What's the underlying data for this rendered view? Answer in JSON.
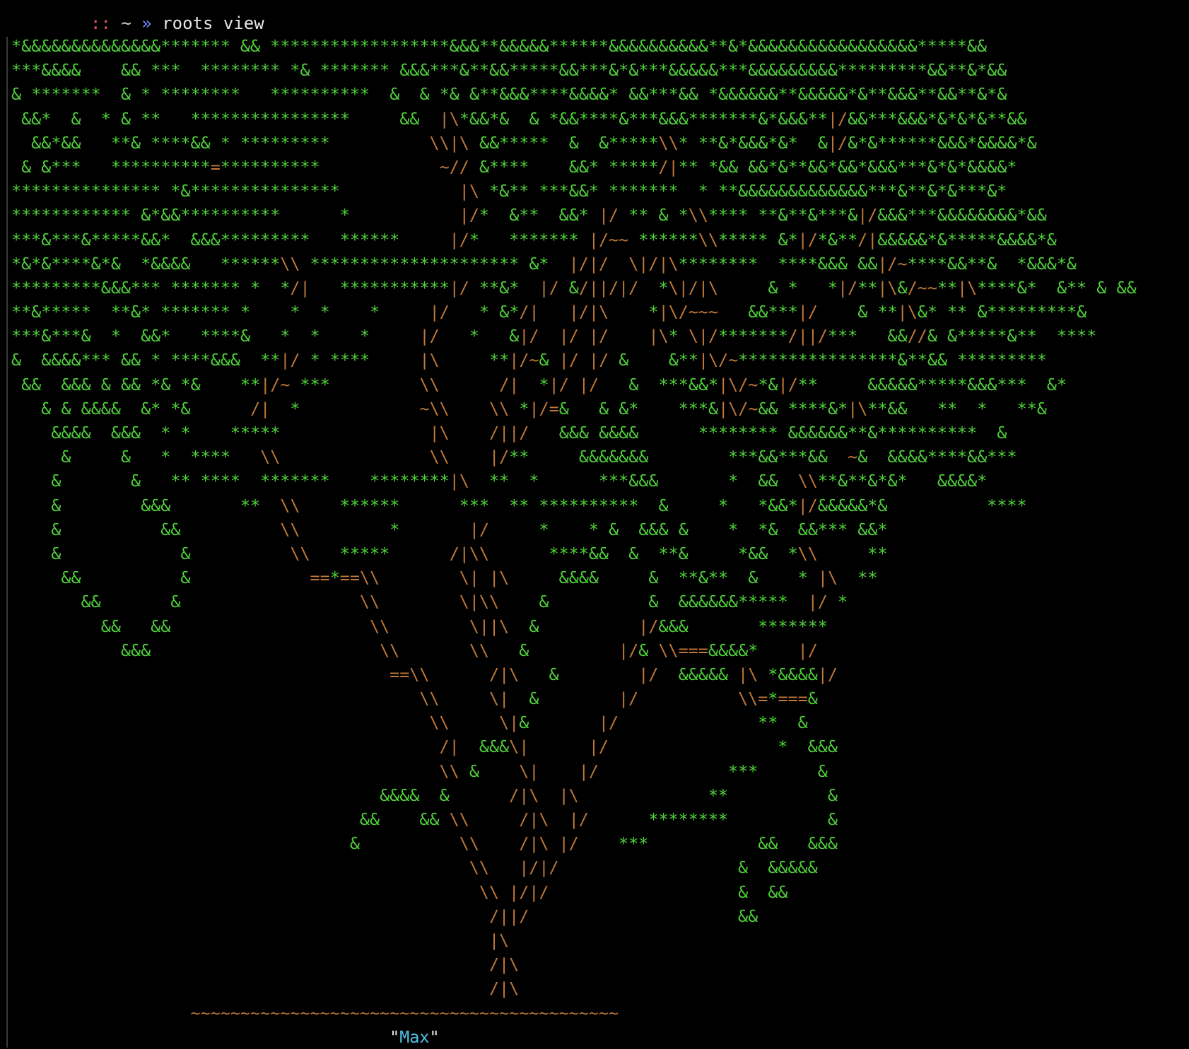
{
  "prompt": {
    "separator": "::",
    "path": "~",
    "arrow": "»",
    "command": "roots view"
  },
  "colors": {
    "leaves": "#4fcf3a",
    "branches": "#c0793a",
    "name": "#4fc3e6",
    "background": "#000000"
  },
  "art_lines": [
    "*&&&&&&&&&&&&&&******* && ******************&&&**&&&&&******&&&&&&&&&&**&*&&&&&&&&&&&&&&&&&*****&&",
    "***&&&&    && ***  ******** *& ******* &&&***&**&&*****&&***&*&***&&&&&***&&&&&&&&&*********&&**&*&&",
    "& *******  & * ********   **********  &  & *& &**&&&****&&&&* &&***&& *&&&&&&**&&&&&*&**&&&**&&**&*&",
    " &&*  &  * & **   ****************     &&  |\\*&&*&  & *&&****&***&&&*******&*&&&**|/&&***&&&*&*&*&**&&",
    "  &&*&&   **& ****&& * *********          \\\\|\\ &&*****  &  &*****\\\\* **&*&&&*&*  &|/&*&******&&&*&&&&*&",
    " & &***   **********=**********            ~// &****    &&* *****/|** *&& &&*&**&&*&&*&&&***&*&*&&&&*",
    "*************** *&***************            |\\ *&** ***&&* *******  * **&&&&&&&&&&&&&***&**&*&***&*",
    "************ &*&&**********      *           |/*  &**  &&* |/ ** & *\\\\**** **&**&***&|/&&&***&&&&&&&&*&&",
    "***&***&*****&&*  &&&*********   ******     |/*   ******* |/~~ ******\\\\***** &*|/*&**/|&&&&&*&*****&&&&*&",
    "*&*&****&*&  *&&&&   ******\\\\ ********************* &*  |/|/  \\|/|\\********  ****&&& &&|/~****&&**&  *&&&*&",
    "*********&&&*** ******* *  */|   ***********|/ **&*  |/ &/||/|/  *\\|/|\\     & *   *|/**|\\&/~~**|\\****&*  &** & &&",
    "**&*****  **&* ******* *    *  *    *     |/   * &*/|   |/|\\    *|\\/~~~   &&***|/    & **|\\&* ** &*********&",
    "***&***&  *  &&*   ****&   *  *    *     |/   *   &|/  |/ |/    |\\* \\|/*******/||/***   &&//& &*****&**  ****",
    "&  &&&&*** && * ****&&&  **|/ * ****     |\\     **|/~& |/ |/ &    &**|\\/~****************&**&& *********",
    " &&  &&& & && *& *&    **|/~ ***         \\\\      /|  *|/ |/   &  ***&&*|\\/~*&|/**     &&&&&*****&&&***  &*",
    "   & & &&&&  &* *&      /|  *            ~\\\\    \\\\ *|/=&   & &*    ***&|\\/~&& ****&*|\\**&&   **  *   **&",
    "    &&&&  &&&  * *    *****               |\\    /||/   &&& &&&&      ******** &&&&&&**&**********  &",
    "     &     &   *  ****   \\\\               \\\\    |/**     &&&&&&&        ***&&***&&  ~&  &&&&****&&***",
    "    &       &   ** ****  *******    ********|\\  **  *      ***&&&       *  &&  \\\\**&**&*&*   &&&&*",
    "    &        &&&       **  \\\\    ******      ***  ** **********  &     *   *&&*|/&&&&&*&          ****",
    "    &          &&          \\\\         *       |/     *    * &  &&& &    *  *&  &&*** &&*",
    "    &            &          \\\\   *****      /|\\\\      ****&&  &  **&     *&&  *\\\\     **",
    "     &&          &            ==*==\\\\        \\| |\\     &&&&     &  **&**  &    * |\\  **",
    "       &&       &                  \\\\        \\|\\\\    &          &  &&&&&&*****  |/ *",
    "         &&   &&                    \\\\        \\||\\  &          |/&&&       *******",
    "           &&&                       \\\\       \\\\   &         |/& \\\\===&&&&*    |/",
    "                                      ==\\\\      /|\\   &        |/  &&&&& |\\ *&&&&|/",
    "                                         \\\\     \\|  &        |/          \\\\=*===&",
    "                                          \\\\     \\|&       |/              **  &",
    "                                           /|  &&&\\|      |/                 *  &&&",
    "                                           \\\\ &    \\|    |/             ***      &",
    "                                     &&&&  &      /|\\  |\\             **          &",
    "                                   &&    && \\\\     /|\\  |/      ********          &",
    "                                  &          \\\\    /|\\ |/    ***           &&   &&&",
    "                                              \\\\   |/|/                  &  &&&&&",
    "                                               \\\\ |/|/                   &  &&",
    "                                                /||/                     &&",
    "                                                |\\",
    "                                                /|\\",
    "                                                /|\\"
  ],
  "ground": "~~~~~~~~~~~~~~~~~~~~~~~~~~~~~~~~~~~~~~~~~~~",
  "name": {
    "open_quote": "\"",
    "text": "Max",
    "close_quote": "\""
  }
}
